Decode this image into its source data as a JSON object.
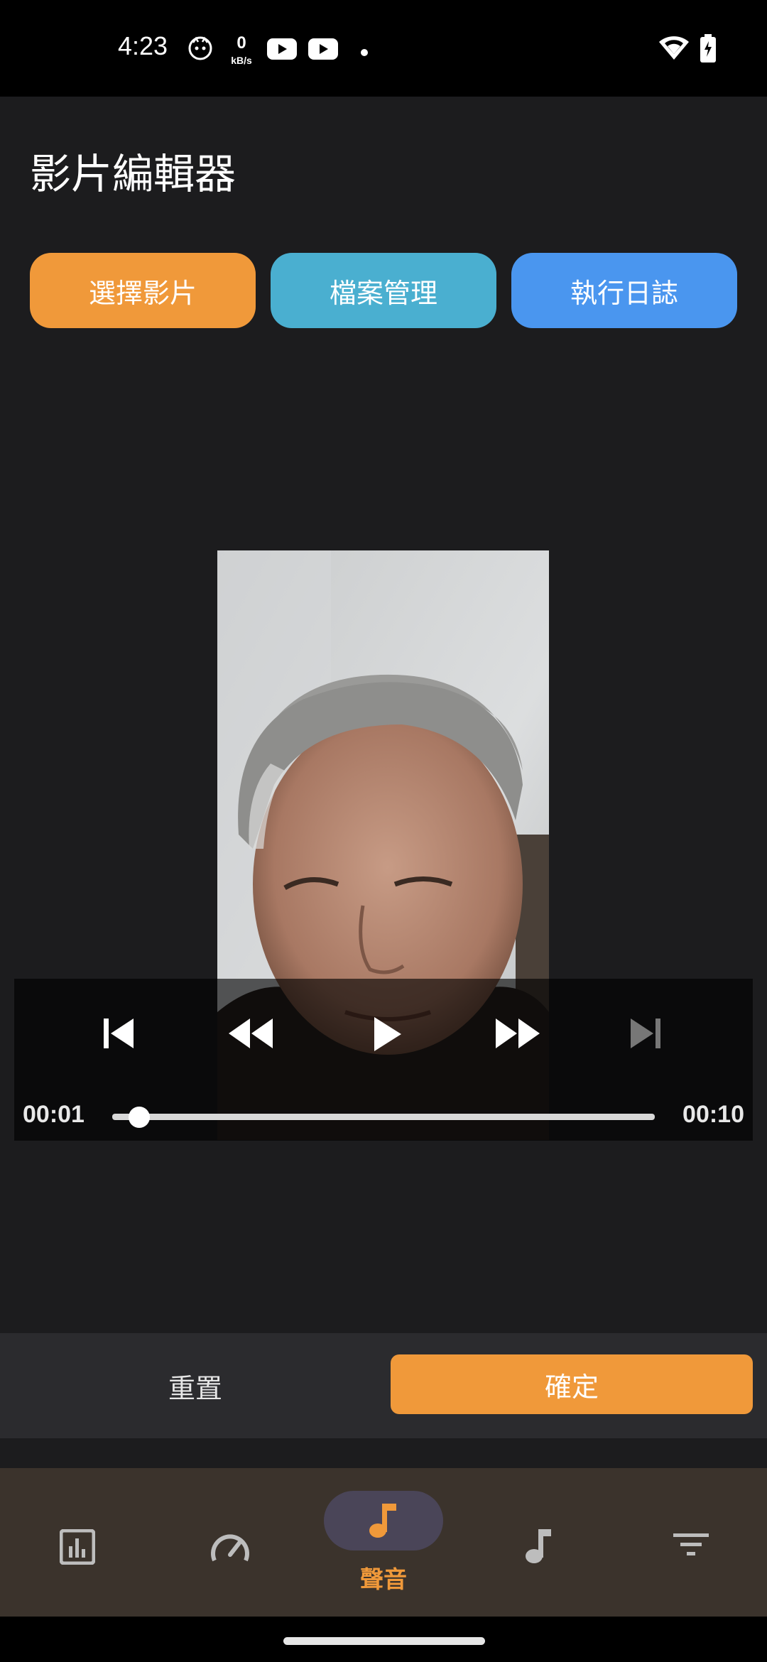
{
  "status_bar": {
    "time": "4:23",
    "net_speed_value": "0",
    "net_speed_unit": "kB/s",
    "icons": [
      "cat-icon",
      "youtube-icon",
      "youtube-icon",
      "dot-icon",
      "wifi-icon",
      "battery-charging-icon"
    ]
  },
  "app": {
    "title": "影片編輯器",
    "buttons": {
      "select_video": "選擇影片",
      "file_manager": "檔案管理",
      "run_log": "執行日誌"
    }
  },
  "player": {
    "current_time": "00:01",
    "total_time": "00:10",
    "progress_fraction": 0.05,
    "controls": [
      "skip-previous-icon",
      "rewind-icon",
      "play-icon",
      "fast-forward-icon",
      "skip-next-icon"
    ]
  },
  "actions": {
    "reset": "重置",
    "confirm": "確定"
  },
  "bottom_nav": {
    "items": [
      {
        "icon": "equalizer-icon",
        "label": ""
      },
      {
        "icon": "speed-icon",
        "label": ""
      },
      {
        "icon": "music-note-icon",
        "label": "聲音",
        "active": true
      },
      {
        "icon": "music-note-icon",
        "label": ""
      },
      {
        "icon": "filter-icon",
        "label": ""
      }
    ]
  },
  "colors": {
    "accent": "#f0993a",
    "teal": "#4aafd0",
    "blue": "#4a96ef",
    "background": "#1c1c1e",
    "nav_background": "#3b332c"
  }
}
